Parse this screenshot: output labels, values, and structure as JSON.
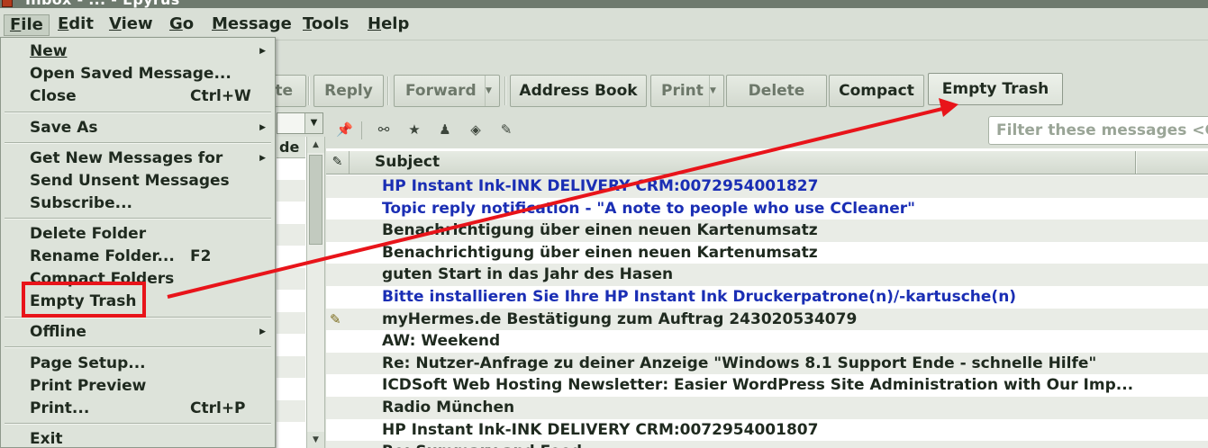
{
  "window": {
    "title": "Inbox - ... - Epyrus"
  },
  "menubar": {
    "items": [
      {
        "label": "File",
        "access": "F",
        "rest": "ile"
      },
      {
        "label": "Edit",
        "access": "E",
        "rest": "dit"
      },
      {
        "label": "View",
        "access": "V",
        "rest": "iew"
      },
      {
        "label": "Go",
        "access": "G",
        "rest": "o"
      },
      {
        "label": "Message",
        "access": "M",
        "rest": "essage"
      },
      {
        "label": "Tools",
        "access": "T",
        "rest": "ools"
      },
      {
        "label": "Help",
        "access": "H",
        "rest": "elp"
      }
    ]
  },
  "toolbar": {
    "delete_partial": "te",
    "reply": "Reply",
    "forward": "Forward",
    "address_book": "Address Book",
    "print": "Print",
    "delete": "Delete",
    "compact": "Compact",
    "empty_trash": "Empty Trash"
  },
  "filter": {
    "placeholder": "Filter these messages <C"
  },
  "folderpane": {
    "header_partial": "de"
  },
  "messagelist": {
    "subject_header": "Subject",
    "rows": [
      {
        "subject": "HP Instant Ink-INK DELIVERY CRM:0072954001827",
        "unread": true,
        "attachment": false
      },
      {
        "subject": "Topic reply notification - \"A note to people who use CCleaner\"",
        "unread": true,
        "attachment": false
      },
      {
        "subject": "Benachrichtigung über einen neuen Kartenumsatz",
        "unread": false,
        "attachment": false
      },
      {
        "subject": "Benachrichtigung über einen neuen Kartenumsatz",
        "unread": false,
        "attachment": false
      },
      {
        "subject": "guten Start in das Jahr des Hasen",
        "unread": false,
        "attachment": false
      },
      {
        "subject": "Bitte installieren Sie Ihre HP Instant Ink Druckerpatrone(n)/-kartusche(n)",
        "unread": true,
        "attachment": false
      },
      {
        "subject": "myHermes.de Bestätigung zum Auftrag 243020534079",
        "unread": false,
        "attachment": true
      },
      {
        "subject": "AW: Weekend",
        "unread": false,
        "attachment": false
      },
      {
        "subject": "Re: Nutzer-Anfrage zu deiner Anzeige \"Windows 8.1 Support Ende - schnelle Hilfe\"",
        "unread": false,
        "attachment": false
      },
      {
        "subject": "ICDSoft Web Hosting Newsletter: Easier WordPress Site Administration with Our Imp...",
        "unread": false,
        "attachment": false
      },
      {
        "subject": "Radio München",
        "unread": false,
        "attachment": false
      },
      {
        "subject": "HP Instant Ink-INK DELIVERY CRM:0072954001807",
        "unread": false,
        "attachment": false
      },
      {
        "subject": "Re: Summary and Food",
        "unread": false,
        "attachment": false
      }
    ]
  },
  "filemenu": {
    "new": "New",
    "open_saved": "Open Saved Message...",
    "close": "Close",
    "close_key": "Ctrl+W",
    "save_as": "Save As",
    "get_new": "Get New Messages for",
    "send_unsent": "Send Unsent Messages",
    "subscribe": "Subscribe...",
    "delete_folder": "Delete Folder",
    "rename_folder": "Rename Folder...",
    "rename_key": "F2",
    "compact_folders": "Compact Folders",
    "empty_trash": "Empty Trash",
    "offline": "Offline",
    "page_setup": "Page Setup...",
    "print_preview": "Print Preview",
    "print": "Print...",
    "print_key": "Ctrl+P",
    "exit": "Exit"
  },
  "colors": {
    "annotation_red": "#e8141a",
    "unread_blue": "#1a2eb4",
    "chrome_green": "#d9dfd6"
  }
}
